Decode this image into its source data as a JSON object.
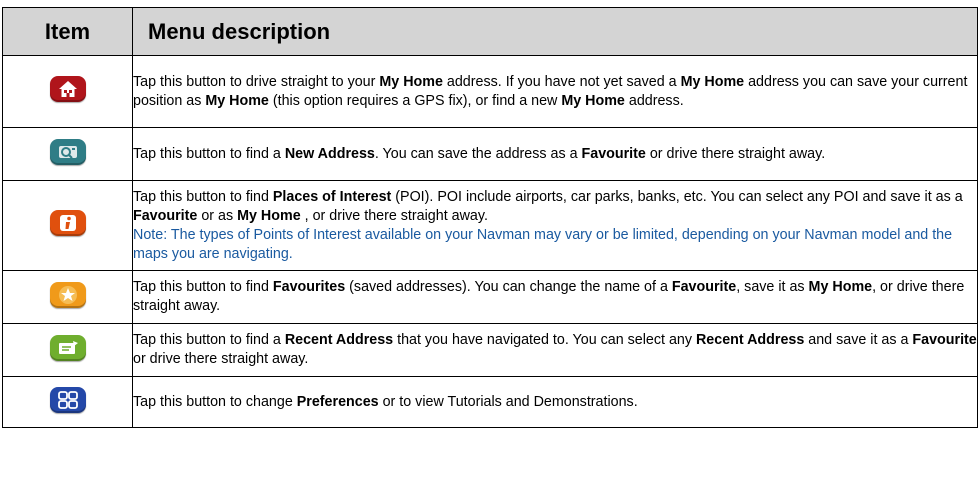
{
  "headers": {
    "item": "Item",
    "description": "Menu description"
  },
  "rows": [
    {
      "icon": "home-icon",
      "color": "#b0151b",
      "parts": [
        {
          "t": "Tap this button to drive straight to your "
        },
        {
          "t": "My Home",
          "b": true
        },
        {
          "t": " address. If you have not yet saved a "
        },
        {
          "t": "My Home",
          "b": true
        },
        {
          "t": " address you can save your current position as "
        },
        {
          "t": "My Home",
          "b": true
        },
        {
          "t": " (this option requires a GPS fix), or find a new "
        },
        {
          "t": "My Home",
          "b": true
        },
        {
          "t": " address."
        }
      ]
    },
    {
      "icon": "new-address-icon",
      "color": "#2f7d86",
      "parts": [
        {
          "t": "Tap this button to find a "
        },
        {
          "t": "New Address",
          "b": true
        },
        {
          "t": ". You can save the address as a "
        },
        {
          "t": "Favourite",
          "b": true
        },
        {
          "t": " or drive there straight away."
        }
      ]
    },
    {
      "icon": "info-icon",
      "color": "#e0500e",
      "parts": [
        {
          "t": "Tap this button to find "
        },
        {
          "t": "Places of Interest",
          "b": true
        },
        {
          "t": " (POI). POI include airports, car parks, banks, etc. You can select any POI and save it as a "
        },
        {
          "t": "Favourite",
          "b": true
        },
        {
          "t": " or as "
        },
        {
          "t": "My Home",
          "b": true
        },
        {
          "t": " , or drive there straight away."
        }
      ],
      "note": "Note: The types of Points of Interest available on your Navman may vary or be limited, depending on your Navman model and the maps you are navigating."
    },
    {
      "icon": "star-icon",
      "color": "#f09a1a",
      "parts": [
        {
          "t": "Tap this button to find "
        },
        {
          "t": "Favourites",
          "b": true
        },
        {
          "t": " (saved addresses). You can change the name of a "
        },
        {
          "t": "Favourite",
          "b": true
        },
        {
          "t": ", save it as "
        },
        {
          "t": "My Home",
          "b": true
        },
        {
          "t": ", or drive there straight away."
        }
      ]
    },
    {
      "icon": "recent-address-icon",
      "color": "#6fae2e",
      "parts": [
        {
          "t": "Tap this button to find a "
        },
        {
          "t": "Recent Address",
          "b": true
        },
        {
          "t": " that you have navigated to. You can select any "
        },
        {
          "t": "Recent Address",
          "b": true
        },
        {
          "t": " and save it as a "
        },
        {
          "t": "Favourite",
          "b": true
        },
        {
          "t": " or drive there straight away."
        }
      ]
    },
    {
      "icon": "preferences-icon",
      "color": "#2448a8",
      "parts": [
        {
          "t": "Tap this button to change "
        },
        {
          "t": "Preferences",
          "b": true
        },
        {
          "t": " or to view Tutorials and Demonstrations."
        }
      ]
    }
  ]
}
